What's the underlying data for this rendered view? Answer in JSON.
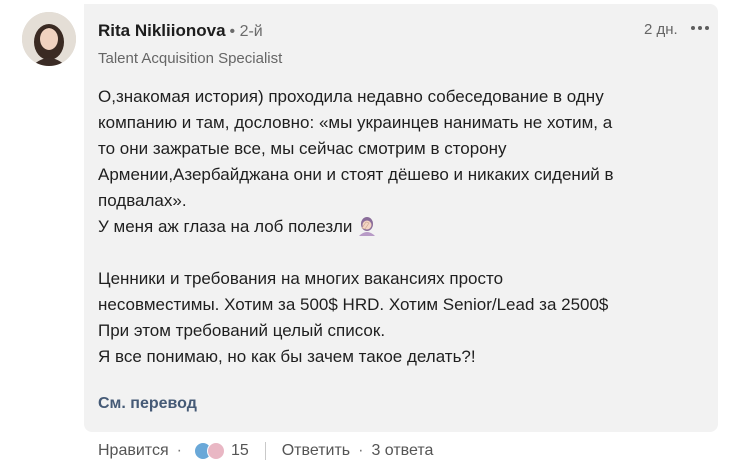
{
  "author": {
    "name": "Rita Nikliionova",
    "degree": "• 2-й",
    "headline": "Talent Acquisition Specialist"
  },
  "timestamp": "2 дн.",
  "comment": {
    "lines": [
      "О,знакомая история) проходила недавно собеседование в одну",
      "компанию и там, дословно: «мы украинцев нанимать не хотим, а",
      "то они зажратые все, мы сейчас смотрим в сторону",
      "Армении,Азербайджана они и стоят дёшево и никаких сидений в",
      "подвалах».",
      "У меня аж глаза на лоб полезли",
      "",
      "Ценники и требования на многих вакансиях просто",
      "несовместимы. Хотим за 500$ HRD. Хотим Senior/Lead за 2500$",
      "При этом требований целый список.",
      "Я все понимаю, но как бы зачем такое делать?!"
    ],
    "emoji": "facepalm-woman-emoji"
  },
  "translate_label": "См. перевод",
  "actions": {
    "like_label": "Нравится",
    "dot": "·",
    "reaction_count": "15",
    "reactions": [
      {
        "icon": "celebrate-icon",
        "color": "#6aa8d8"
      },
      {
        "icon": "support-icon",
        "color": "#e9b7c4"
      }
    ],
    "reply_label": "Ответить",
    "replies_label": "3 ответа"
  }
}
